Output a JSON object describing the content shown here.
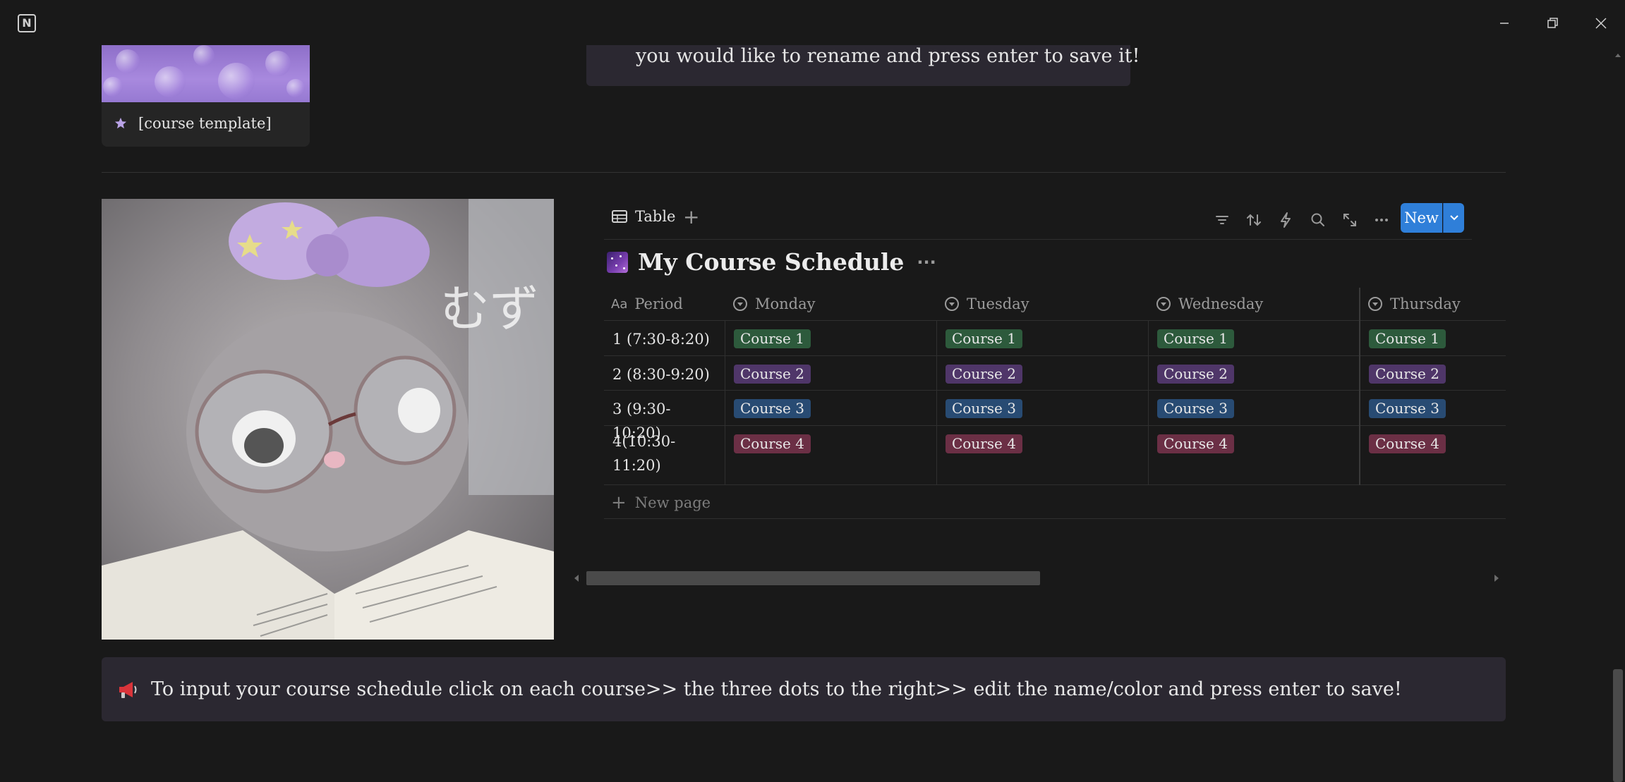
{
  "window": {
    "app_logo": "N",
    "controls": [
      "minimize-icon",
      "restore-icon",
      "close-icon"
    ]
  },
  "top_callout": {
    "text": "you would like to rename and press enter to save it!"
  },
  "gallery_card": {
    "icon": "star-icon",
    "title": "[course template]"
  },
  "database": {
    "view_tab": "Table",
    "add_view": "+",
    "toolbar_icons": [
      "filter-icon",
      "sort-icon",
      "automation-icon",
      "search-icon",
      "expand-icon",
      "more-icon"
    ],
    "new_button": "New",
    "title": "My Course Schedule",
    "title_more": "···",
    "columns": [
      {
        "key": "period",
        "label": "Period",
        "icon": "text-property-icon",
        "icon_text": "Aa"
      },
      {
        "key": "monday",
        "label": "Monday",
        "icon": "select-property-icon"
      },
      {
        "key": "tuesday",
        "label": "Tuesday",
        "icon": "select-property-icon"
      },
      {
        "key": "wednesday",
        "label": "Wednesday",
        "icon": "select-property-icon"
      },
      {
        "key": "thursday",
        "label": "Thursday",
        "icon": "select-property-icon"
      }
    ],
    "rows": [
      {
        "period": "1 (7:30-8:20)",
        "course": "Course 1",
        "color": "green"
      },
      {
        "period": "2 (8:30-9:20)",
        "course": "Course 2",
        "color": "purple"
      },
      {
        "period": "3 (9:30-10:20)",
        "course": "Course 3",
        "color": "blue"
      },
      {
        "period_lines": [
          "4(10:30-",
          "11:20)"
        ],
        "course": "Course 4",
        "color": "red"
      }
    ],
    "new_page": "New page",
    "tag_colors": {
      "green": "#2d5a3c",
      "purple": "#4f3669",
      "blue": "#284b73",
      "red": "#6b2f45"
    }
  },
  "callout": {
    "icon": "megaphone-icon",
    "text": "To input your course schedule click on each course>> the three dots to the right>> edit the name/color and press enter to save!"
  },
  "colors": {
    "background": "#191919",
    "callout_bg": "#2b2831",
    "accent": "#2f7fd9"
  }
}
